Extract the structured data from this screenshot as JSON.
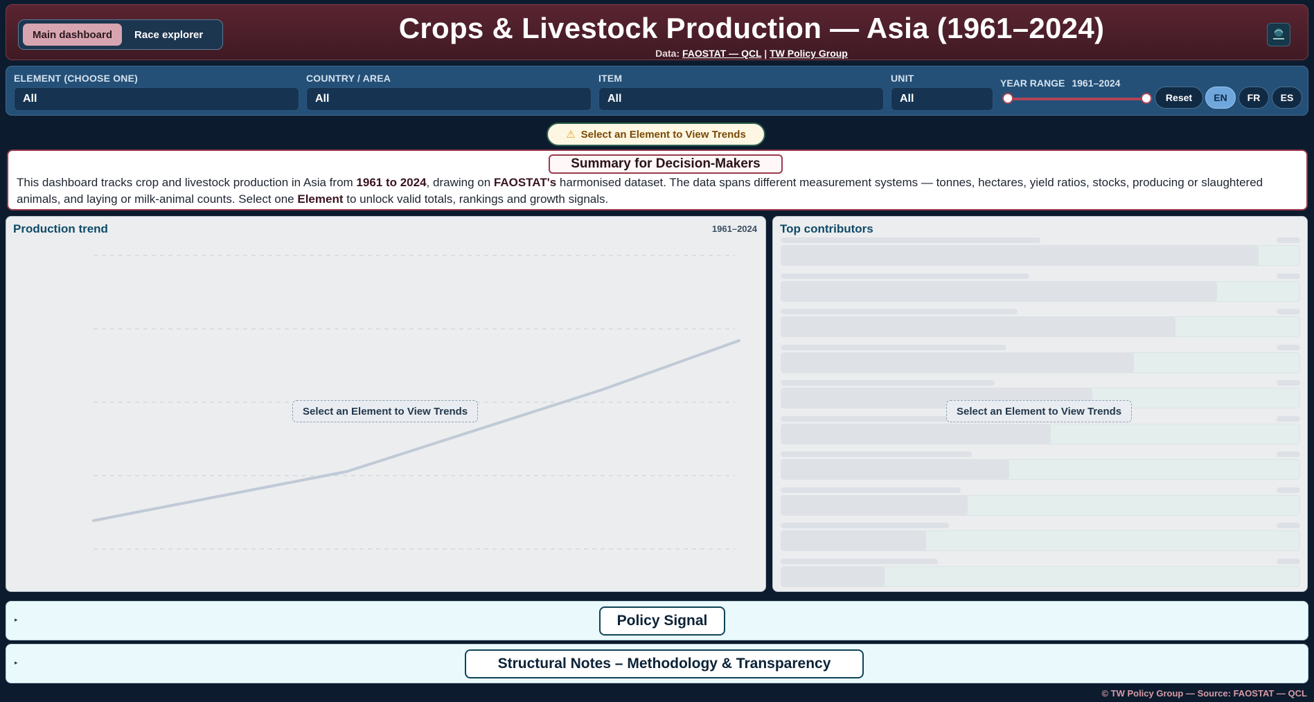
{
  "nav": {
    "main_dashboard": "Main dashboard",
    "race_explorer": "Race explorer"
  },
  "header": {
    "title": "Crops & Livestock Production — Asia (1961–2024)",
    "data_prefix": "Data:",
    "source_link": "FAOSTAT — QCL",
    "separator": "|",
    "group_link": "TW Policy Group",
    "logo_icon": "tw-way-logo-icon"
  },
  "filters": {
    "element": {
      "label": "ELEMENT (CHOOSE ONE)",
      "value": "All"
    },
    "country": {
      "label": "COUNTRY / AREA",
      "value": "All"
    },
    "item": {
      "label": "ITEM",
      "value": "All"
    },
    "unit": {
      "label": "UNIT",
      "value": "All"
    },
    "year_range": {
      "label": "YEAR RANGE",
      "value": "1961–2024",
      "min": 1961,
      "max": 2024
    },
    "reset": "Reset",
    "languages": [
      "EN",
      "FR",
      "ES"
    ],
    "active_language": "EN"
  },
  "alert": {
    "icon": "warning-icon",
    "text": "Select an Element to View Trends"
  },
  "summary": {
    "title": "Summary for Decision-Makers",
    "t1": "This dashboard tracks crop and livestock production in Asia from ",
    "b1": "1961 to 2024",
    "t2": ", drawing on ",
    "b2": "FAOSTAT's",
    "t3": " harmonised dataset. The data spans different measurement systems — tonnes, hectares, yield ratios, stocks, producing or slaughtered animals, and laying or milk-animal counts. Select one ",
    "b3": "Element",
    "t4": " to unlock valid totals, rankings and growth signals."
  },
  "trend_panel": {
    "title": "Production trend",
    "range": "1961–2024",
    "placeholder": "Select an Element to View Trends"
  },
  "contributors_panel": {
    "title": "Top contributors",
    "placeholder": "Select an Element to View Trends",
    "skeleton_bar_fractions": [
      0.92,
      0.84,
      0.76,
      0.68,
      0.6,
      0.52,
      0.44,
      0.36,
      0.28,
      0.2
    ]
  },
  "sections": {
    "policy": "Policy Signal",
    "notes": "Structural Notes – Methodology & Transparency"
  },
  "footer": "© TW Policy Group — Source: FAOSTAT — QCL",
  "colors": {
    "accent_maroon": "#5a2430",
    "filter_blue": "#245077",
    "teal_title": "#0f4a68"
  }
}
